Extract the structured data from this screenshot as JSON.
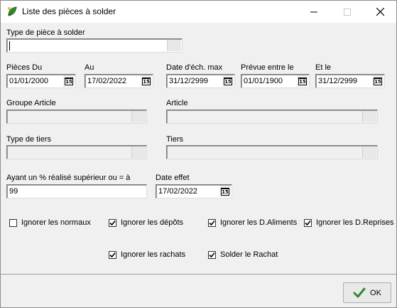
{
  "window": {
    "title": "Liste des pièces à solder",
    "icon": "leaf-app-icon",
    "min_icon": "minimize-icon",
    "max_icon": "maximize-icon",
    "close_icon": "close-icon"
  },
  "form": {
    "type_piece": {
      "label": "Type de pièce à solder",
      "value": ""
    },
    "pieces_du": {
      "label": "Pièces Du",
      "value": "01/01/2000"
    },
    "au": {
      "label": "Au",
      "value": "17/02/2022"
    },
    "date_ech_max": {
      "label": "Date d'éch. max",
      "value": "31/12/2999"
    },
    "prevue_entre": {
      "label": "Prévue entre le",
      "value": "01/01/1900"
    },
    "et_le": {
      "label": "Et le",
      "value": "31/12/2999"
    },
    "groupe_article": {
      "label": "Groupe Article",
      "value": ""
    },
    "article": {
      "label": "Article",
      "value": ""
    },
    "type_tiers": {
      "label": "Type de tiers",
      "value": ""
    },
    "tiers": {
      "label": "Tiers",
      "value": ""
    },
    "pct_realise": {
      "label": "Ayant un % réalisé supérieur ou = à",
      "value": "99"
    },
    "date_effet": {
      "label": "Date effet",
      "value": "17/02/2022"
    },
    "calendar_icon_text": "15"
  },
  "checkboxes": {
    "ignorer_normaux": {
      "label": "Ignorer les normaux",
      "checked": false
    },
    "ignorer_depots": {
      "label": "Ignorer les dépôts",
      "checked": true
    },
    "ignorer_daliments": {
      "label": "Ignorer les D.Aliments",
      "checked": true
    },
    "ignorer_dreprises": {
      "label": "Ignorer les D.Reprises",
      "checked": true
    },
    "ignorer_rachats": {
      "label": "Ignorer les rachats",
      "checked": true
    },
    "solder_rachat": {
      "label": "Solder le Rachat",
      "checked": true
    }
  },
  "buttons": {
    "ok_label": "OK",
    "ok_icon": "checkmark-icon",
    "ok_icon_color": "#2e8b2e"
  }
}
